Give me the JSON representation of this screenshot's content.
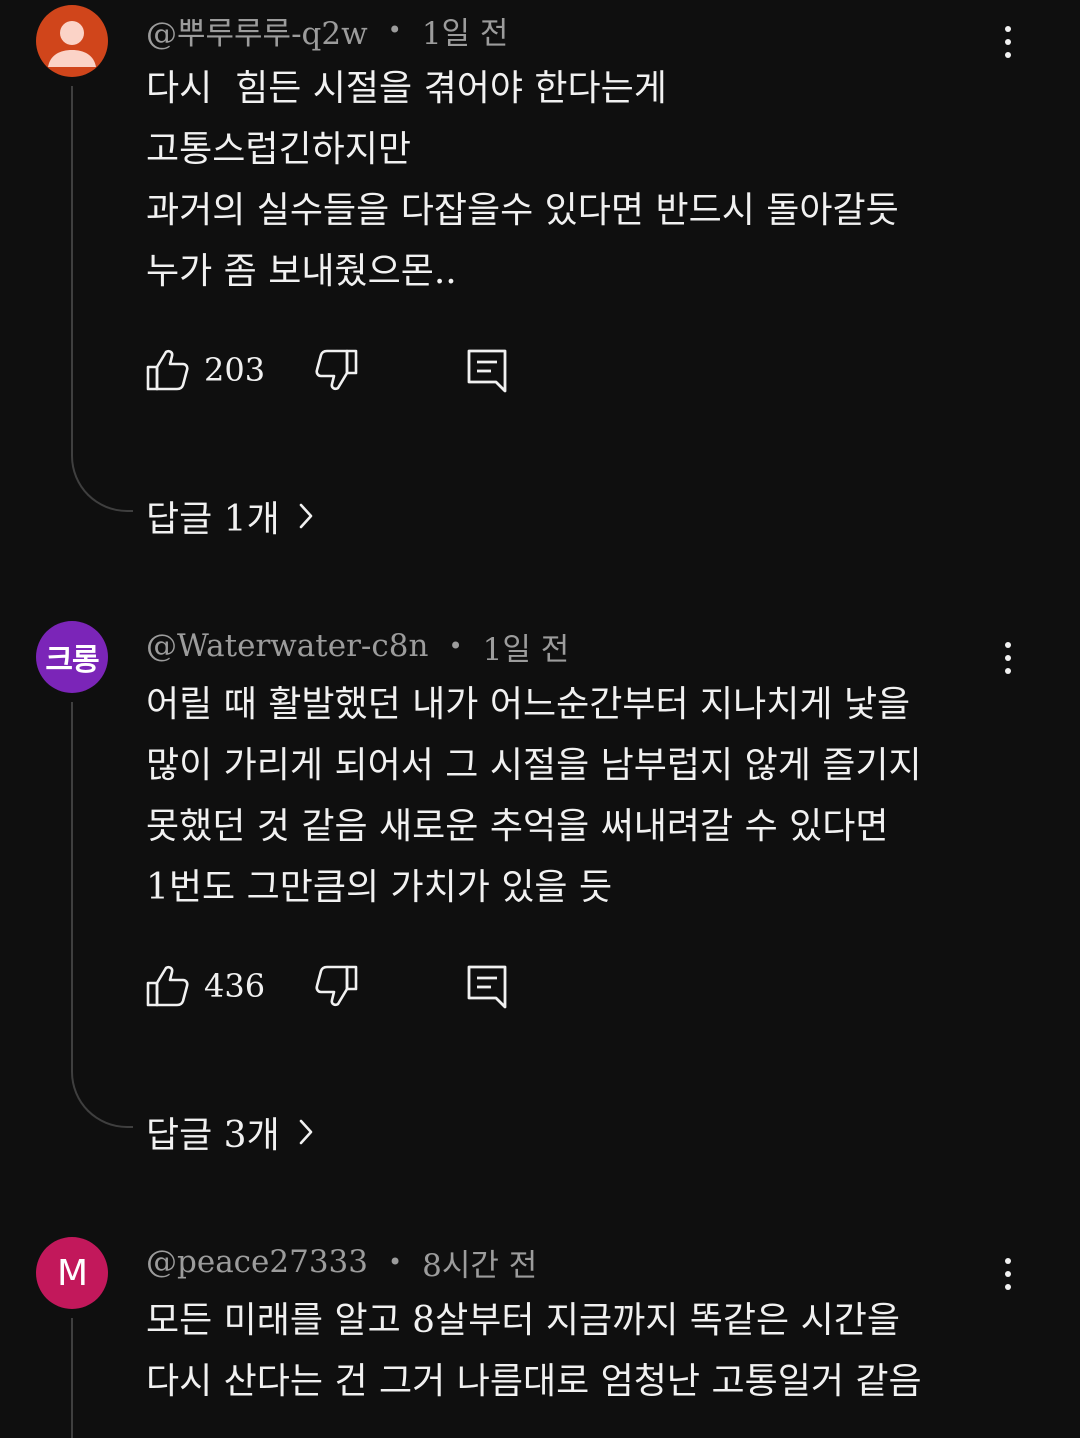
{
  "comments": [
    {
      "author": "@뿌루루루-q2w",
      "time": "1일 전",
      "avatar": {
        "kind": "default-person",
        "color": "#d0451b"
      },
      "lines": [
        "다시  힘든 시절을 겪어야 한다는게",
        "고통스럽긴하지만",
        "과거의 실수들을 다잡을수 있다면 반드시 돌아갈듯",
        "누가 좀 보내줬으몬.."
      ],
      "likes": "203",
      "replies": "답글 1개"
    },
    {
      "author": "@Waterwater-c8n",
      "time": "1일 전",
      "avatar": {
        "text": "크롱",
        "color": "#7b25b8"
      },
      "lines": [
        "어릴 때 활발했던 내가 어느순간부터 지나치게 낯을",
        "많이 가리게 되어서 그 시절을 남부럽지 않게 즐기지",
        "못했던 것 같음 새로운 추억을 써내려갈 수 있다면",
        "1번도 그만큼의 가치가 있을 듯"
      ],
      "likes": "436",
      "replies": "답글 3개"
    },
    {
      "author": "@peace27333",
      "time": "8시간 전",
      "avatar": {
        "text": "M",
        "color": "#c2185b"
      },
      "lines": [
        "모든 미래를 알고 8살부터 지금까지 똑같은 시간을",
        "다시 산다는 건 그거 나름대로 엄청난 고통일거 같음"
      ]
    }
  ],
  "icons": {
    "like": "thumb-up-icon",
    "dislike": "thumb-down-icon",
    "reply": "comment-reply-icon",
    "menu": "more-vertical-icon",
    "chevron": "chevron-right-icon"
  },
  "colors": {
    "background": "#0f0f0f",
    "text": "#f1f1f1",
    "meta": "#9c9c9c",
    "thread": "#3f3f3f"
  }
}
